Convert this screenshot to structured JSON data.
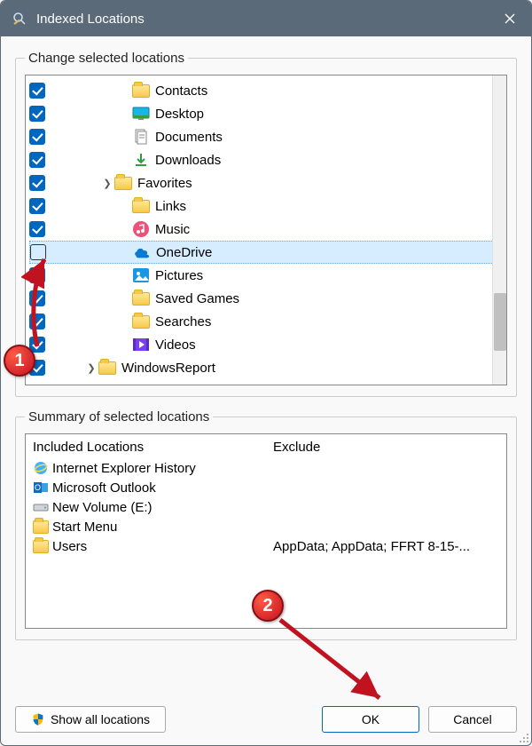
{
  "window": {
    "title": "Indexed Locations"
  },
  "group1": {
    "legend": "Change selected locations"
  },
  "tree": [
    {
      "checked": true,
      "indent": 76,
      "icon": "folder",
      "label": "Contacts"
    },
    {
      "checked": true,
      "indent": 76,
      "icon": "desktop",
      "label": "Desktop"
    },
    {
      "checked": true,
      "indent": 76,
      "icon": "documents",
      "label": "Documents"
    },
    {
      "checked": true,
      "indent": 76,
      "icon": "downloads",
      "label": "Downloads"
    },
    {
      "checked": true,
      "indent": 56,
      "expander": true,
      "icon": "folder",
      "label": "Favorites"
    },
    {
      "checked": true,
      "indent": 76,
      "icon": "folder",
      "label": "Links"
    },
    {
      "checked": true,
      "indent": 76,
      "icon": "music",
      "label": "Music"
    },
    {
      "checked": false,
      "indent": 76,
      "icon": "onedrive",
      "label": "OneDrive",
      "selected": true
    },
    {
      "checked": true,
      "indent": 76,
      "icon": "pictures",
      "label": "Pictures"
    },
    {
      "checked": true,
      "indent": 76,
      "icon": "folder",
      "label": "Saved Games"
    },
    {
      "checked": true,
      "indent": 76,
      "icon": "folder",
      "label": "Searches"
    },
    {
      "checked": true,
      "indent": 76,
      "icon": "videos",
      "label": "Videos"
    },
    {
      "checked": true,
      "indent": 38,
      "expander": true,
      "icon": "folder",
      "label": "WindowsReport"
    }
  ],
  "group2": {
    "legend": "Summary of selected locations",
    "included_header": "Included Locations",
    "exclude_header": "Exclude"
  },
  "included": [
    {
      "icon": "ie",
      "label": "Internet Explorer History"
    },
    {
      "icon": "outlook",
      "label": "Microsoft Outlook"
    },
    {
      "icon": "drive",
      "label": "New Volume (E:)"
    },
    {
      "icon": "folder",
      "label": "Start Menu"
    },
    {
      "icon": "folder",
      "label": "Users"
    }
  ],
  "exclude_rows": [
    "",
    "",
    "",
    "",
    "AppData; AppData; FFRT 8-15-..."
  ],
  "buttons": {
    "show_all": "Show all locations",
    "ok": "OK",
    "cancel": "Cancel"
  },
  "callouts": {
    "one": "1",
    "two": "2"
  }
}
